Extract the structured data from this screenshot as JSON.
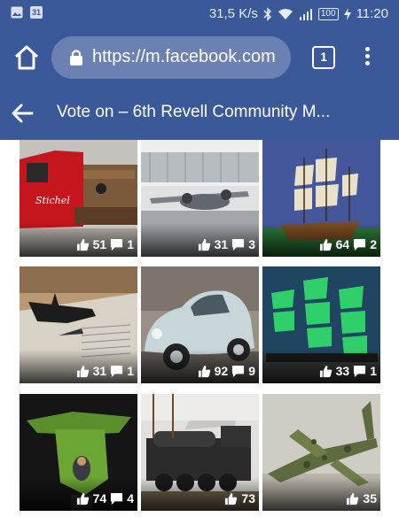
{
  "status_bar": {
    "app_badge": "31",
    "network_speed": "31,5 K/s",
    "battery": "100",
    "time": "11:20"
  },
  "browser": {
    "url": "https://m.facebook.com",
    "tab_count": "1"
  },
  "header": {
    "title": "Vote on – 6th Revell Community M..."
  },
  "album": {
    "photos": [
      {
        "subject": "red truck",
        "likes": "51",
        "comments": "1"
      },
      {
        "subject": "twin-engine airplane",
        "likes": "31",
        "comments": "3"
      },
      {
        "subject": "sailing ship",
        "likes": "64",
        "comments": "2"
      },
      {
        "subject": "stealth jet",
        "likes": "31",
        "comments": "1"
      },
      {
        "subject": "beetle car",
        "likes": "92",
        "comments": "9"
      },
      {
        "subject": "green sail ship",
        "likes": "33",
        "comments": "1"
      },
      {
        "subject": "green gunship",
        "likes": "74",
        "comments": "4"
      },
      {
        "subject": "steam locomotive",
        "likes": "73",
        "comments": ""
      },
      {
        "subject": "camouflage jet",
        "likes": "35",
        "comments": ""
      }
    ]
  },
  "colors": {
    "facebook_blue": "#3b5998",
    "url_pill": "#6b81b3"
  }
}
